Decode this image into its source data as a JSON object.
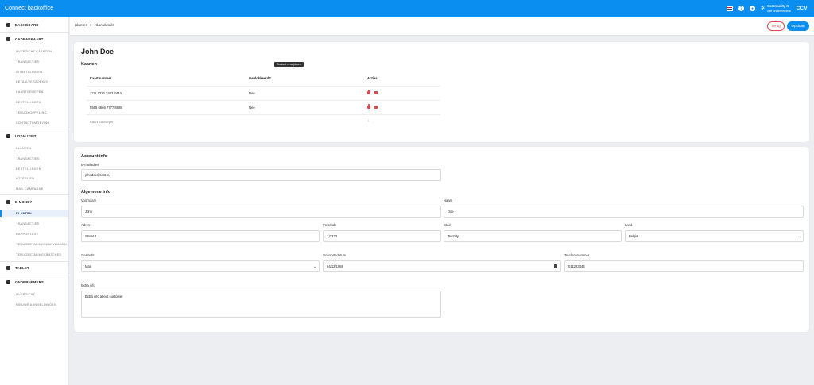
{
  "app": {
    "title": "Connect backoffice",
    "company": "Community X",
    "company_sub": "Alle ondernemers",
    "brand": "CCV",
    "accent": "#0a8ef0",
    "danger": "#e0474c"
  },
  "header": {
    "breadcrumb": [
      "Klanten",
      ">",
      "Klantdetails"
    ],
    "back_label": "Terug",
    "save_label": "Opslaan"
  },
  "sidebar": {
    "sections": [
      {
        "label": "DASHBOARD",
        "icon": "grid-icon",
        "items": []
      },
      {
        "label": "CADEAUKAART",
        "icon": "gift-icon",
        "items": [
          "OVERZICHT KAARTEN",
          "TRANSACTIES",
          "UITBETALINGEN",
          "BETAALVERZOEKEN",
          "KAARTGROEPEN",
          "BESTELLINGEN",
          "TERUGKOPPELING",
          "CONTACTOMGEVING"
        ]
      },
      {
        "label": "LOYALITEIT",
        "icon": "tag-icon",
        "items": [
          "KLANTEN",
          "TRANSACTIES",
          "BESTELLINGEN",
          "LOTERIJEN",
          "MAIL CAMPAGNE"
        ]
      },
      {
        "label": "E-MONEY",
        "icon": "card-icon",
        "items": [
          "KLANTEN",
          "TRANSACTIES",
          "RAPPORTAGE",
          "TERUGBETALINGSAANVRAGEN",
          "TERUGBETALINGSBATCHES"
        ],
        "active": "KLANTEN"
      },
      {
        "label": "TABLET",
        "icon": "tablet-icon",
        "items": []
      },
      {
        "label": "ONDERNEMERS",
        "icon": "store-icon",
        "items": [
          "OVERZICHT",
          "NIEUWE AANMELDINGEN"
        ]
      }
    ]
  },
  "customer": {
    "name": "John Doe",
    "tooltip": "Contact verwijderen",
    "cards_title": "Kaarten",
    "cards_columns": [
      "Kaartnummer",
      "Geblokkeerd?",
      "Acties"
    ],
    "cards": [
      {
        "number": "1111 2222 3333 4444",
        "blocked": "Nee"
      },
      {
        "number": "5555 6666 7777 8888",
        "blocked": "Nee"
      }
    ],
    "add_card": "Kaart toevoegen"
  },
  "account": {
    "title": "Account info",
    "email_label": "E-mailadres",
    "email": "johndoe@test.eu"
  },
  "general": {
    "title": "Algemene info",
    "firstname_label": "Voornaam",
    "firstname": "John",
    "lastname_label": "Naam",
    "lastname": "Doe",
    "address_label": "Adres",
    "address": "Street 1",
    "postcode_label": "Postcode",
    "postcode": "1)2233",
    "city_label": "Stad",
    "city": "Testcity",
    "country_label": "Land",
    "country": "België",
    "gender_label": "Geslacht",
    "gender": "Man",
    "birthdate_label": "Geboortedatum",
    "birthdate": "04/12/1986",
    "phone_label": "Telefoonnummer",
    "phone": "011223344",
    "extra_label": "Extra info",
    "extra": "Extra info about customer"
  }
}
